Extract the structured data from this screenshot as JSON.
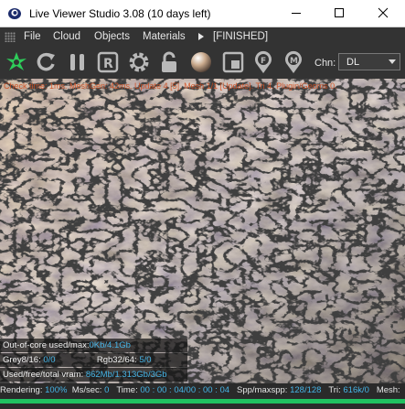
{
  "window": {
    "title": "Live Viewer Studio 3.08 (10 days left)",
    "minimize_icon": "minimize-icon",
    "maximize_icon": "maximize-icon",
    "close_icon": "close-icon"
  },
  "menubar": {
    "items": [
      "File",
      "Cloud",
      "Objects",
      "Materials"
    ],
    "more_icon": "chevron-right-icon",
    "status": "[FINISHED]"
  },
  "toolbar": {
    "icons": [
      "render-logo-icon",
      "refresh-icon",
      "pause-icon",
      "region-render-icon",
      "settings-gear-icon",
      "lock-icon",
      "material-ball-icon",
      "film-region-icon",
      "focus-picker-icon",
      "material-picker-icon"
    ],
    "channel_label": "Chn:",
    "channel_value": "DL"
  },
  "viewport": {
    "overlay_text": "Check time: 1ms. MeshGen: 42ms. Update 4 [5]. Mesh 1/1 [Update]. Tri 4. Plugin/Geoms 0.",
    "colors": {
      "accent": "#46b4e6",
      "progress": "#20c060",
      "overlay": "#d24a1a"
    }
  },
  "stats": {
    "outofcore_label": "Out-of-core used/max:",
    "outofcore_value": "0Kb/4.1Gb",
    "grey_label": "Grey8/16:",
    "grey_value": "0/0",
    "rgb_label": "Rgb32/64:",
    "rgb_value": "5/0",
    "vram_label": "Used/free/total vram:",
    "vram_value": "862Mb/1.313Gb/3Gb"
  },
  "statusbar": {
    "rendering_label": "Rendering:",
    "rendering_value": "100%",
    "ms_label": "Ms/sec:",
    "ms_value": "0",
    "time_label": "Time:",
    "time_value": "00 : 00 : 04/00 : 00 : 04",
    "spp_label": "Spp/maxspp:",
    "spp_value": "128/128",
    "tri_label": "Tri:",
    "tri_value": "616k/0",
    "mesh_label": "Mesh:",
    "progress_percent": 100
  }
}
